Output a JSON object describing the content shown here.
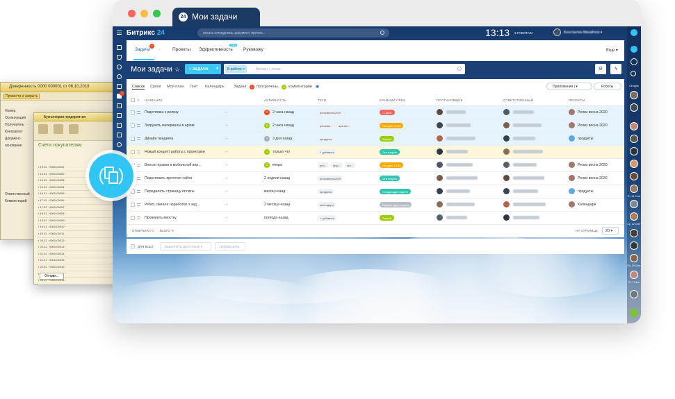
{
  "window": {
    "tab_title": "Мои задачи",
    "tab_badge": "24",
    "colors": {
      "close": "#fc605c",
      "minimize": "#fdbc40",
      "maximize": "#34c84a",
      "accent": "#2fc6f6",
      "header_blue": "#1c3b64"
    }
  },
  "topbar": {
    "logo_main": "Битрикс",
    "logo_num": "24",
    "search_placeholder": "искать сотрудника, документ, прочее...",
    "clock": "13:13",
    "work_status": "РАБОТАЮ",
    "user_name": "Константин Михайлов"
  },
  "subnav": {
    "items": [
      {
        "label": "Задачи",
        "badge": "7"
      },
      {
        "label": "Проекты"
      },
      {
        "label": "Эффективность",
        "badge": "95%"
      },
      {
        "label": "Руковожу"
      }
    ],
    "more": "Еще"
  },
  "toolbar": {
    "title": "Мои задачи",
    "add_button": "+ ЗАДАЧА",
    "filter_chip": "В работе",
    "filter_placeholder": "Фильтр + поиск"
  },
  "views": {
    "items": [
      "Список",
      "Сроки",
      "Мой план",
      "Гант",
      "Календарь"
    ],
    "counter_label": "Задачи",
    "overdue_count": "1",
    "overdue_label": "просрочены,",
    "comments_count": "6",
    "comments_label": "комментарии",
    "apps_button": "Приложения",
    "robots_button": "Роботы"
  },
  "grid": {
    "columns": [
      "НАЗВАНИЕ",
      "АКТИВНОСТЬ",
      "ТЕГИ",
      "КРАЙНИЙ СРОК",
      "ПОСТАНОВЩИК",
      "ОТВЕТСТВЕННЫЙ",
      "ПРОЕКТЫ"
    ],
    "rows": [
      {
        "title": "Подготовка к релизу",
        "act_num": "2",
        "act_color": "#f54819",
        "activity": "2 часа назад",
        "tags": [
          "релизвесна2020"
        ],
        "deadline": "-1 день",
        "dl_color": "#f5655e",
        "project": "Релиз весна 2020",
        "state": "sel"
      },
      {
        "title": "Загрузить материалы в архив",
        "act_num": "2",
        "act_color": "#9dcf00",
        "activity": "2 часа назад",
        "tags": [
          "релизве...",
          "архивн..."
        ],
        "deadline": "Сегодня 19:00",
        "dl_color": "#ffa900",
        "project": "Релиз весна 2020",
        "state": "sel"
      },
      {
        "title": "Дизайн лендинга",
        "act_num": "3",
        "act_color": "#a8adb4",
        "activity": "3 дня назад",
        "tags": [
          "продукты"
        ],
        "deadline": "Завтра",
        "dl_color": "#9dcf00",
        "project": "продукты",
        "state": "sel"
      },
      {
        "title": "Новый концепт работы с проектами",
        "act_num": "1",
        "act_color": "#9dcf00",
        "activity": "только что",
        "tags": [
          "+ добавить"
        ],
        "deadline": "Эта неделя",
        "dl_color": "#2fc6b0",
        "project": "",
        "state": "new"
      },
      {
        "title": "Внести правки в мобильной вер...",
        "act_num": "1",
        "act_color": "#9dcf00",
        "activity": "вчера",
        "tags": [
          "рел...",
          "фор...",
          "опт..."
        ],
        "deadline": "Сегодня 19:00",
        "dl_color": "#ffa900",
        "project": "Релиз весна 2020",
        "state": ""
      },
      {
        "title": "Подготовить прототип сайта",
        "act_num": "",
        "act_color": "",
        "activity": "2 недели назад",
        "tags": [
          "релизвесна2020"
        ],
        "deadline": "Эта неделя",
        "dl_color": "#2fc6b0",
        "project": "Релиз весна 2020",
        "state": ""
      },
      {
        "title": "Передалать страницу оплаты",
        "act_num": "",
        "act_color": "",
        "activity": "месяц назад",
        "tags": [
          "продукты"
        ],
        "deadline": "Следующая неделя",
        "dl_color": "#2fc6b0",
        "project": "продукты",
        "state": ""
      },
      {
        "title": "Ребят, скиньте наработки п зад...",
        "act_num": "",
        "act_color": "",
        "activity": "2 месяца назад",
        "tags": [
          "календари"
        ],
        "deadline": "Больше двух недель",
        "dl_color": "#b7bec5",
        "project": "Календари",
        "state": ""
      },
      {
        "title": "Проверить верстку",
        "act_num": "",
        "act_color": "",
        "activity": "полгода назад",
        "tags": [
          "+ добавить"
        ],
        "deadline": "Завтра",
        "dl_color": "#9dcf00",
        "project": "",
        "state": ""
      }
    ],
    "footer_selected": "ОТМЕЧЕНО: 0",
    "footer_total": "ВСЕГО: 9",
    "per_page_label": "НА СТРАНИЦЕ:",
    "per_page_value": "20"
  },
  "bulk": {
    "all_label": "ДЛЯ ВСЕХ",
    "action_placeholder": "ВЫБЕРИТЕ ДЕЙСТВИЕ",
    "apply": "ПРИМЕНИТЬ"
  },
  "rightbar": {
    "today": "Сегодня",
    "dates": [
      "Пт, 14 Септ",
      "Ср, 12 Септ",
      "Пн, 10 Септ",
      "Пт, 7 Септ"
    ]
  },
  "onec": {
    "win1_title": "Доверенность 0000 000001 от 06.10.2018",
    "win1_tools": "Провести и закрыть",
    "win1_side": [
      "Номер",
      "Организация",
      "Получатель",
      "Контрагент",
      "Документ-основание",
      "Ответственный",
      "Комментарий"
    ],
    "win2_title": "Бухгалтерия предприятия",
    "win2_heading": "Счета покупателям",
    "win2_button": "Отпрвк..."
  }
}
